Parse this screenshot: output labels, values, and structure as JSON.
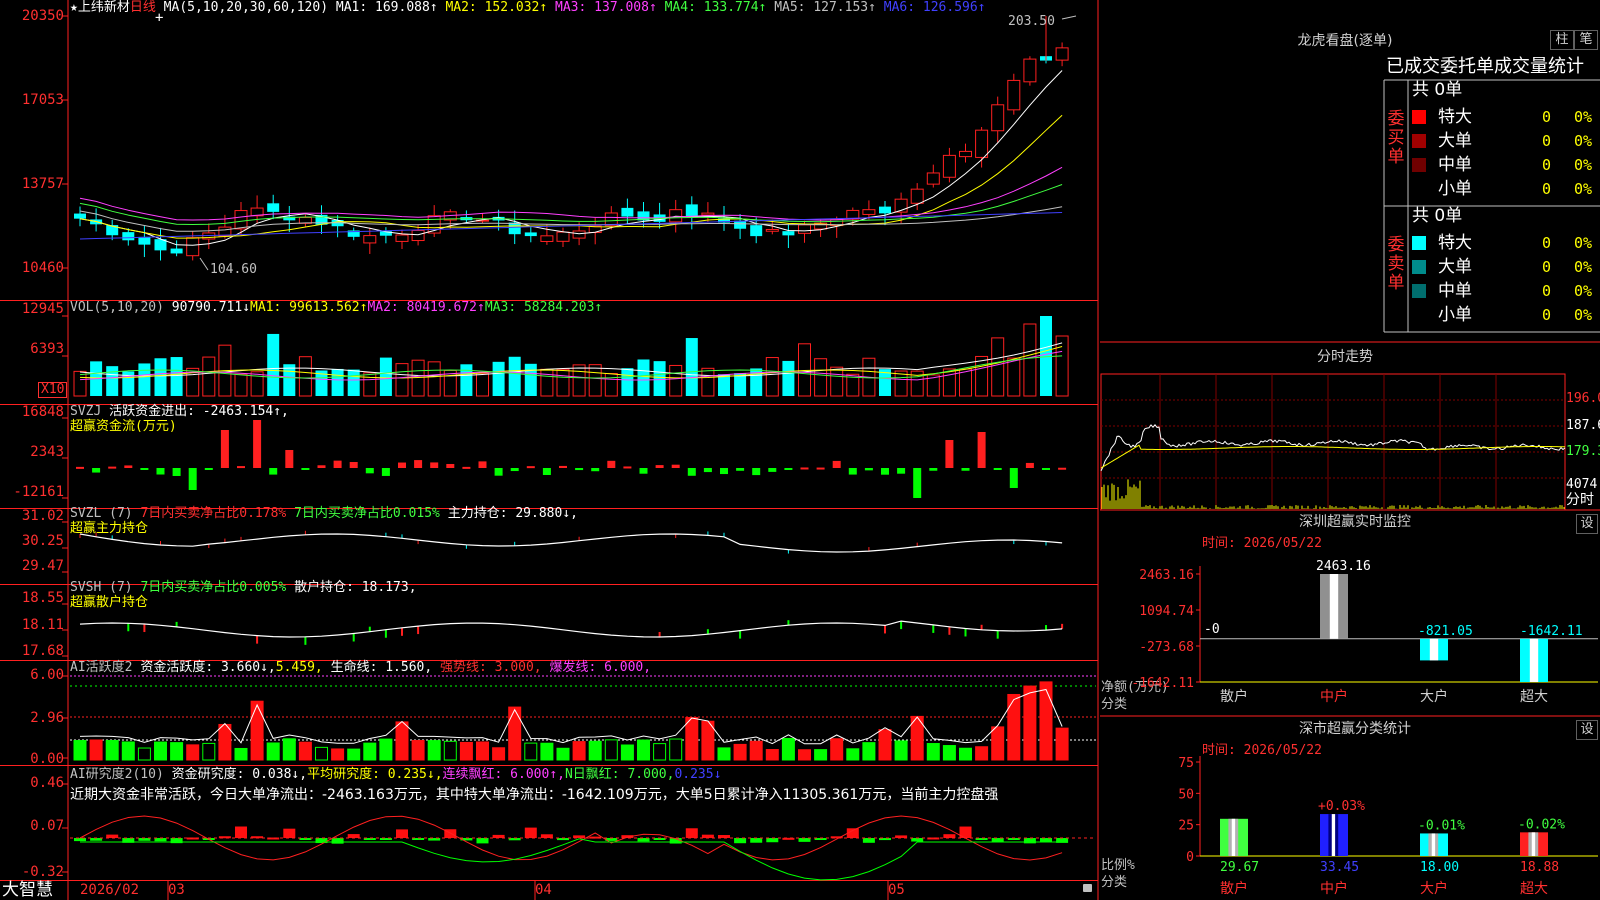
{
  "header": {
    "stock_name": "★上纬新材",
    "period": "日线",
    "cursor_mark": "+",
    "ma_label": "MA(5,10,20,30,60,120)",
    "ma_items": [
      {
        "text": "MA1: 169.088↑",
        "color": "#ffffff"
      },
      {
        "text": "MA2: 152.032↑",
        "color": "#ffff00"
      },
      {
        "text": "MA3: 137.008↑",
        "color": "#ff40ff"
      },
      {
        "text": "MA4: 133.774↑",
        "color": "#40ff40"
      },
      {
        "text": "MA5: 127.153↑",
        "color": "#c0c0c0"
      },
      {
        "text": "MA6: 126.596↑",
        "color": "#4040ff"
      }
    ],
    "high_label": "203.50",
    "low_label": "104.60"
  },
  "price_axis": [
    "20350",
    "17053",
    "13757",
    "10460"
  ],
  "vol": {
    "label": "VOL(5,10,20)",
    "value": "90790.711↓",
    "ma1": "MA1: 99613.562↑",
    "ma2": "MA2: 80419.672↑",
    "ma3": "MA3: 58284.203↑",
    "axis": [
      "12945",
      "6393"
    ],
    "unit": "X10"
  },
  "svzj": {
    "label": "SVZJ",
    "item": "活跃资金进出: -2463.154↑,",
    "subtitle": "超赢资金流(万元)",
    "axis": [
      "16848",
      "2343",
      "-12161"
    ]
  },
  "svzl": {
    "label": "SVZL (7)",
    "item1": "7日内买卖净占比0.178%",
    "item2": "7日内买卖净占比0.015%",
    "item3": "主力持仓: 29.880↓,",
    "subtitle": "超赢主力持仓",
    "axis": [
      "31.02",
      "30.25",
      "29.47"
    ]
  },
  "svsh": {
    "label": "SVSH (7)",
    "item1": "7日内买卖净占比0.005%",
    "item2": "散户持仓: 18.173,",
    "subtitle": "超赢散户持仓",
    "axis": [
      "18.55",
      "18.11",
      "17.68"
    ]
  },
  "ai_active": {
    "label": "AI活跃度2",
    "item1": "资金活跃度: 3.660↓,",
    "item2": "5.459,",
    "item3": "生命线: 1.560,",
    "item4": "强势线: 3.000,",
    "item5": "爆发线: 6.000,",
    "axis": [
      "6.00",
      "2.96",
      "0.00"
    ]
  },
  "ai_research": {
    "label": "AI研究度2(10)",
    "item1": "资金研究度: 0.038↓,",
    "item2": "平均研究度: 0.235↓,",
    "item3": "连续飘红: 6.000↑,",
    "item4": "N日飘红: 7.000,",
    "item5": "0.235↓",
    "comment": "近期大资金非常活跃，今日大单净流出：-2463.163万元，其中特大单净流出：-1642.109万元，大单5日累计净入11305.361万元，当前主力控盘强",
    "axis": [
      "0.46",
      "0.07",
      "-0.32"
    ]
  },
  "footer": {
    "brand": "大智慧",
    "dates": [
      "2026/02",
      "03",
      "04",
      "05"
    ]
  },
  "dragon_panel": {
    "title": "龙虎看盘(逐单)",
    "btn_bar": "柱",
    "btn_pen": "笔",
    "subtitle": "已成交委托单成交量统计",
    "buy_label": "委买单",
    "sell_label": "委卖单",
    "buy_total": "共 0单",
    "sell_total": "共 0单",
    "buy_rows": [
      {
        "name": "特大",
        "count": "0",
        "pct": "0%",
        "color": "#ff0000"
      },
      {
        "name": "大单",
        "count": "0",
        "pct": "0%",
        "color": "#a00000"
      },
      {
        "name": "中单",
        "count": "0",
        "pct": "0%",
        "color": "#700000"
      },
      {
        "name": "小单",
        "count": "0",
        "pct": "0%",
        "color": ""
      }
    ],
    "sell_rows": [
      {
        "name": "特大",
        "count": "0",
        "pct": "0%",
        "color": "#00ffff"
      },
      {
        "name": "大单",
        "count": "0",
        "pct": "0%",
        "color": "#008c8c"
      },
      {
        "name": "中单",
        "count": "0",
        "pct": "0%",
        "color": "#006e6e"
      },
      {
        "name": "小单",
        "count": "0",
        "pct": "0%",
        "color": ""
      }
    ]
  },
  "intraday": {
    "title": "分时走势",
    "price_labels": [
      "196.0",
      "187.6",
      "179.3"
    ],
    "vol_label": "4074",
    "unit": "分时"
  },
  "sz_monitor": {
    "title": "深圳超赢实时监控",
    "btn": "设",
    "time": "时间: 2026/05/22",
    "axis": [
      "2463.16",
      "1094.74",
      "-273.68",
      "-1642.11"
    ],
    "zero_label": "-0",
    "ylabel1": "净额(万元)",
    "ylabel2": "分类",
    "categories": [
      "散户",
      "中户",
      "大户",
      "超大"
    ],
    "cat_colors": [
      "#d0d0d0",
      "#ff3030",
      "#d0d0d0",
      "#d0d0d0"
    ]
  },
  "sz_class": {
    "title": "深市超赢分类统计",
    "btn": "设",
    "time": "时间: 2026/05/22",
    "axis": [
      "75",
      "50",
      "25",
      "0"
    ],
    "ylabel1": "比例%",
    "ylabel2": "分类",
    "categories": [
      "散户",
      "中户",
      "大户",
      "超大"
    ],
    "cat_colors": [
      "#ff3030",
      "#ff3030",
      "#ff3030",
      "#ff3030"
    ]
  },
  "chart_data": [
    {
      "type": "bar",
      "title": "深圳超赢实时监控",
      "categories": [
        "散户",
        "中户",
        "大户",
        "超大"
      ],
      "values": [
        0,
        2463.16,
        -821.05,
        -1642.11
      ],
      "value_labels": [
        "-0",
        "2463.16",
        "-821.05",
        "-1642.11"
      ],
      "ylabel": "净额(万元)",
      "xlabel": "分类",
      "ylim": [
        -1642.11,
        2463.16
      ]
    },
    {
      "type": "bar",
      "title": "深市超赢分类统计",
      "categories": [
        "散户",
        "中户",
        "大户",
        "超大"
      ],
      "values": [
        29.67,
        33.45,
        18.0,
        18.88
      ],
      "change_labels": [
        "",
        "+0.03%",
        "-0.01%",
        "-0.02%"
      ],
      "value_labels": [
        "29.67",
        "33.45",
        "18.00",
        "18.88"
      ],
      "ylabel": "比例%",
      "xlabel": "分类",
      "ylim": [
        0,
        75
      ]
    }
  ]
}
